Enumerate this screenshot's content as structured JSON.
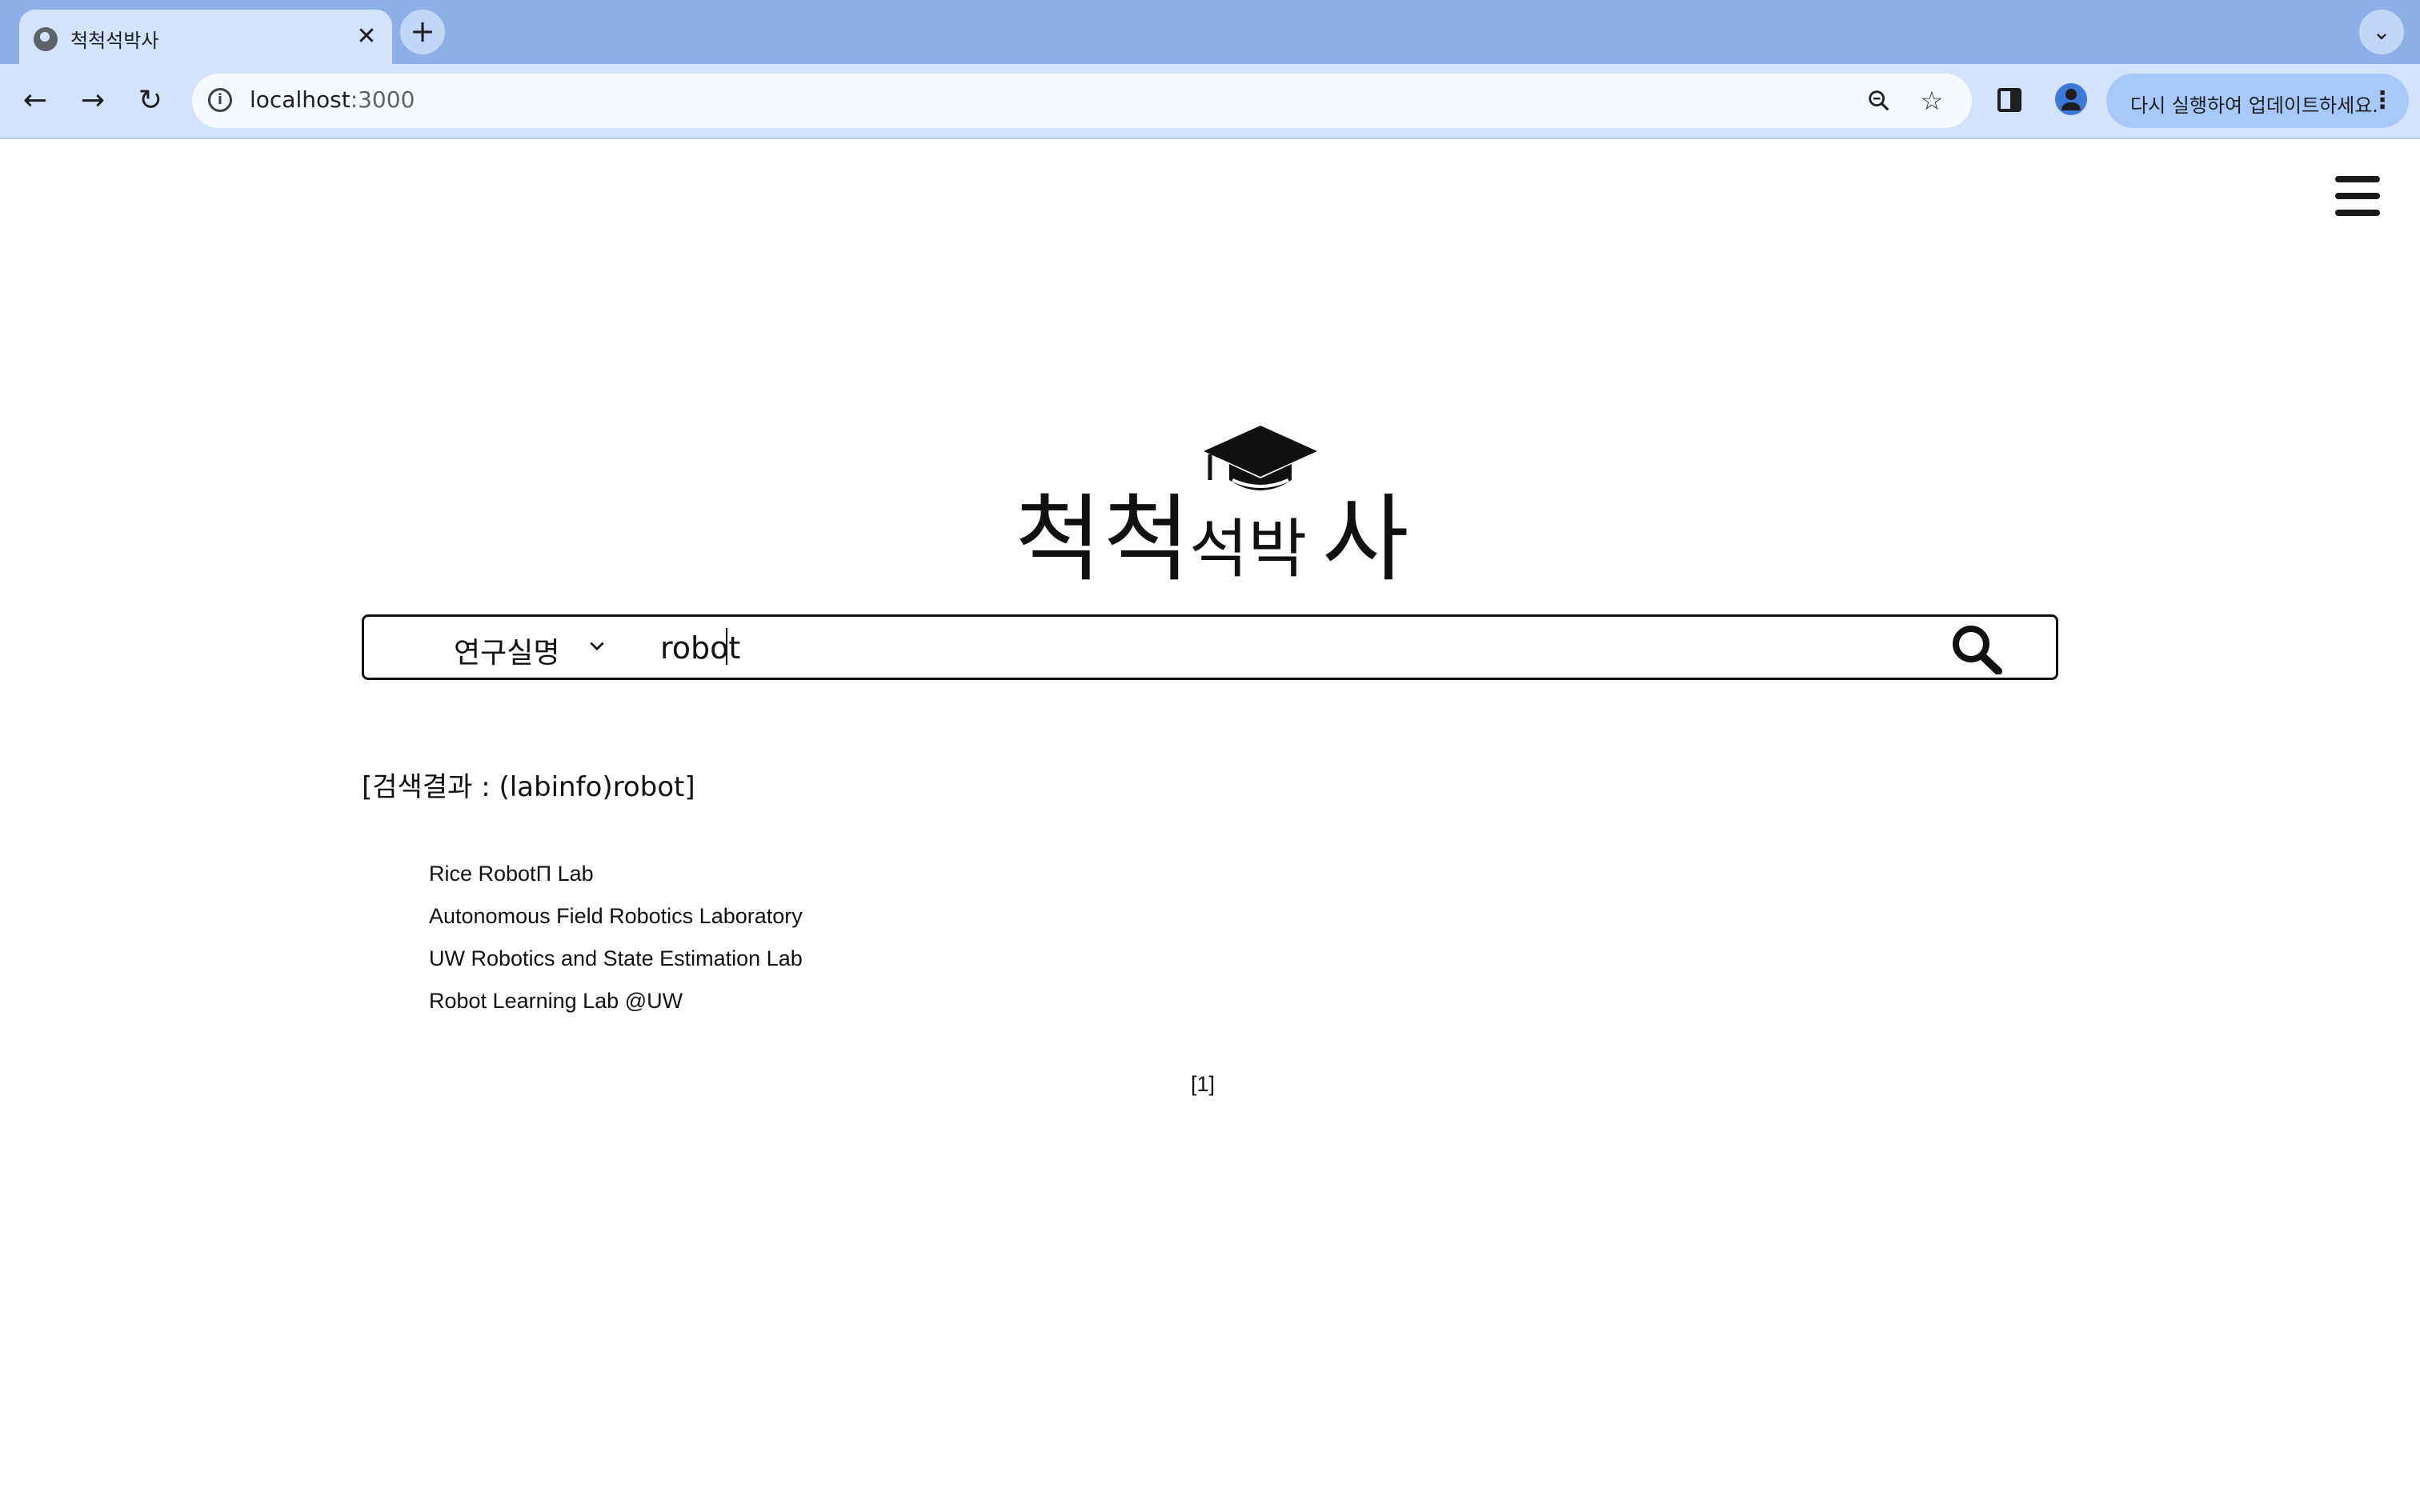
{
  "browser": {
    "tab_title": "척척석박사",
    "tab_close": "✕",
    "new_tab": "+",
    "tab_menu": "⌄",
    "url_host": "localhost",
    "url_port": ":3000",
    "update_text": "다시 실행하여 업데이트하세요.",
    "update_menu": "⋮",
    "info_icon": "i"
  },
  "logo": {
    "part1": "척척",
    "part2": "석박",
    "part3": "사",
    "icon": "graduation-cap-icon"
  },
  "search": {
    "category": "연구실명",
    "query": "robot"
  },
  "results": {
    "heading": "[검색결과 : (labinfo)robot]",
    "items": [
      "Rice RobotΠ Lab",
      "Autonomous Field Robotics Laboratory",
      "UW Robotics and State Estimation Lab",
      "Robot Learning Lab @UW"
    ],
    "pagination": "[1]"
  }
}
